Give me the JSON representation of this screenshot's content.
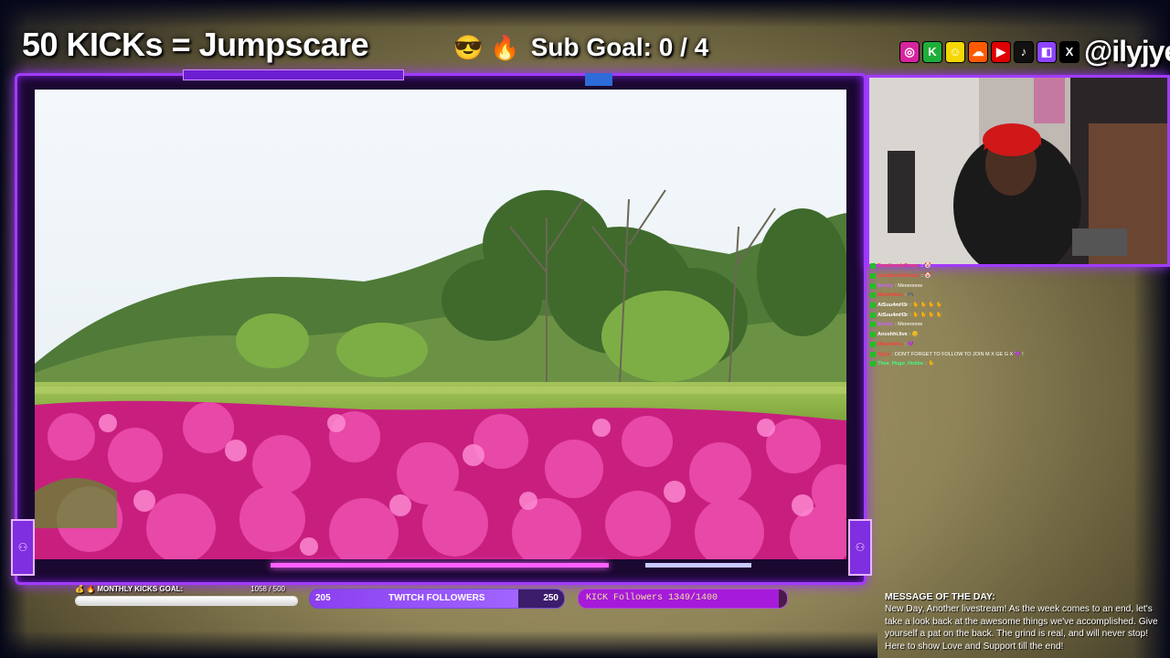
{
  "header": {
    "kicks_title": "50 KICKs = Jumpscare",
    "sub_goal_emojis": [
      "😎",
      "🔥"
    ],
    "sub_goal_text": "Sub Goal:  0 / 4",
    "handle": "@ilyjye",
    "social_icons": [
      {
        "name": "instagram-icon",
        "glyph": "◎",
        "color": "#d6249f"
      },
      {
        "name": "kick-icon",
        "glyph": "K",
        "color": "#1fae3a"
      },
      {
        "name": "snapchat-icon",
        "glyph": "☺",
        "color": "#f4d800"
      },
      {
        "name": "soundcloud-icon",
        "glyph": "☁",
        "color": "#ff5a00"
      },
      {
        "name": "youtube-icon",
        "glyph": "▶",
        "color": "#e00000"
      },
      {
        "name": "tiktok-icon",
        "glyph": "♪",
        "color": "#111111"
      },
      {
        "name": "twitch-icon",
        "glyph": "◧",
        "color": "#8e44ff"
      },
      {
        "name": "x-icon",
        "glyph": "X",
        "color": "#000000"
      }
    ]
  },
  "chat": {
    "lines": [
      {
        "user": "DeadInsidePeace",
        "msg": ":: 🤡",
        "color": "#ff4040"
      },
      {
        "user": "DeadInsidePeace",
        "msg": ":: 🤡",
        "color": "#ff4040"
      },
      {
        "user": "Bobby",
        "msg": ": Meeeooow",
        "color": "#c860ff"
      },
      {
        "user": "Micshelles",
        "msg": ": 🎮",
        "color": "#ff3b3b"
      },
      {
        "user": "AtSuu4mH3r",
        "msg": ": 🐈 🐈 🐈 🐈",
        "color": "#ffffff"
      },
      {
        "user": "AtSuu4mH3r",
        "msg": ": 🐈 🐈 🐈 🐈",
        "color": "#ffffff"
      },
      {
        "user": "Bobby",
        "msg": ": Meeeooow",
        "color": "#c860ff"
      },
      {
        "user": "Anoshhi.live",
        "msg": ": 😊",
        "color": "#ffffff"
      },
      {
        "user": "Micshelles",
        "msg": ": 💜",
        "color": "#ff3b3b"
      },
      {
        "user": "ilyjye",
        "msg": ": DON'T FORGET TO FOLLOW TO JOIN M X GE G X 💜 !",
        "color": "#ff4040"
      },
      {
        "user": "Thee_Hugo_Hobbs",
        "msg": ": 🐈",
        "color": "#40ff80"
      }
    ]
  },
  "motd": {
    "heading": "MESSAGE OF THE DAY:",
    "body": "New Day, Another livestream! As the week comes to an end, let's take a look back at the awesome things we've accomplished. Give yourself a pat on the back. The grind is real, and will never stop! Here to show Love and Support till the end!"
  },
  "bottom": {
    "kicks_goal_label": "💰 🔥 MONTHLY KICKS GOAL:",
    "kicks_goal_value": "1058  / 500",
    "kicks_goal_fraction": 1.0,
    "twitch_start": "205",
    "twitch_label": "TWITCH FOLLOWERS",
    "twitch_end": "250",
    "twitch_fraction": 0.82,
    "kick_followers_label": "KICK Followers 1349/1400",
    "kick_followers_fraction": 0.96
  },
  "frame": {
    "side_badge_glyph": "⚇",
    "accent_color": "#a13bff"
  }
}
